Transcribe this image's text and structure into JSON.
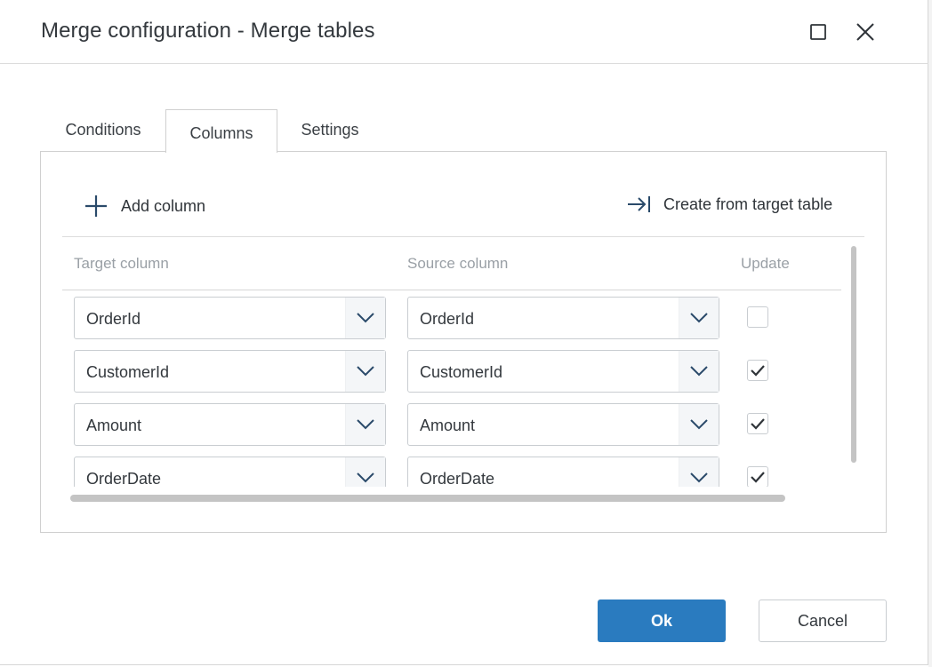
{
  "window": {
    "title": "Merge configuration - Merge tables",
    "maximize_icon": "maximize-icon",
    "close_icon": "close-icon"
  },
  "tabs": [
    {
      "label": "Conditions",
      "active": false
    },
    {
      "label": "Columns",
      "active": true
    },
    {
      "label": "Settings",
      "active": false
    }
  ],
  "toolbar": {
    "add_column_label": "Add column",
    "add_column_icon": "plus-icon",
    "create_from_label": "Create from target table",
    "create_from_icon": "arrow-to-bar-icon"
  },
  "grid": {
    "headers": {
      "target": "Target column",
      "source": "Source column",
      "update": "Update"
    },
    "rows": [
      {
        "target": "OrderId",
        "source": "OrderId",
        "update": false
      },
      {
        "target": "CustomerId",
        "source": "CustomerId",
        "update": true
      },
      {
        "target": "Amount",
        "source": "Amount",
        "update": true
      },
      {
        "target": "OrderDate",
        "source": "OrderDate",
        "update": true
      }
    ]
  },
  "footer": {
    "ok_label": "Ok",
    "cancel_label": "Cancel"
  },
  "colors": {
    "primary": "#2a7bbf",
    "border": "#c9cdd1",
    "header_text": "#9aa0a6",
    "text": "#33383d"
  }
}
